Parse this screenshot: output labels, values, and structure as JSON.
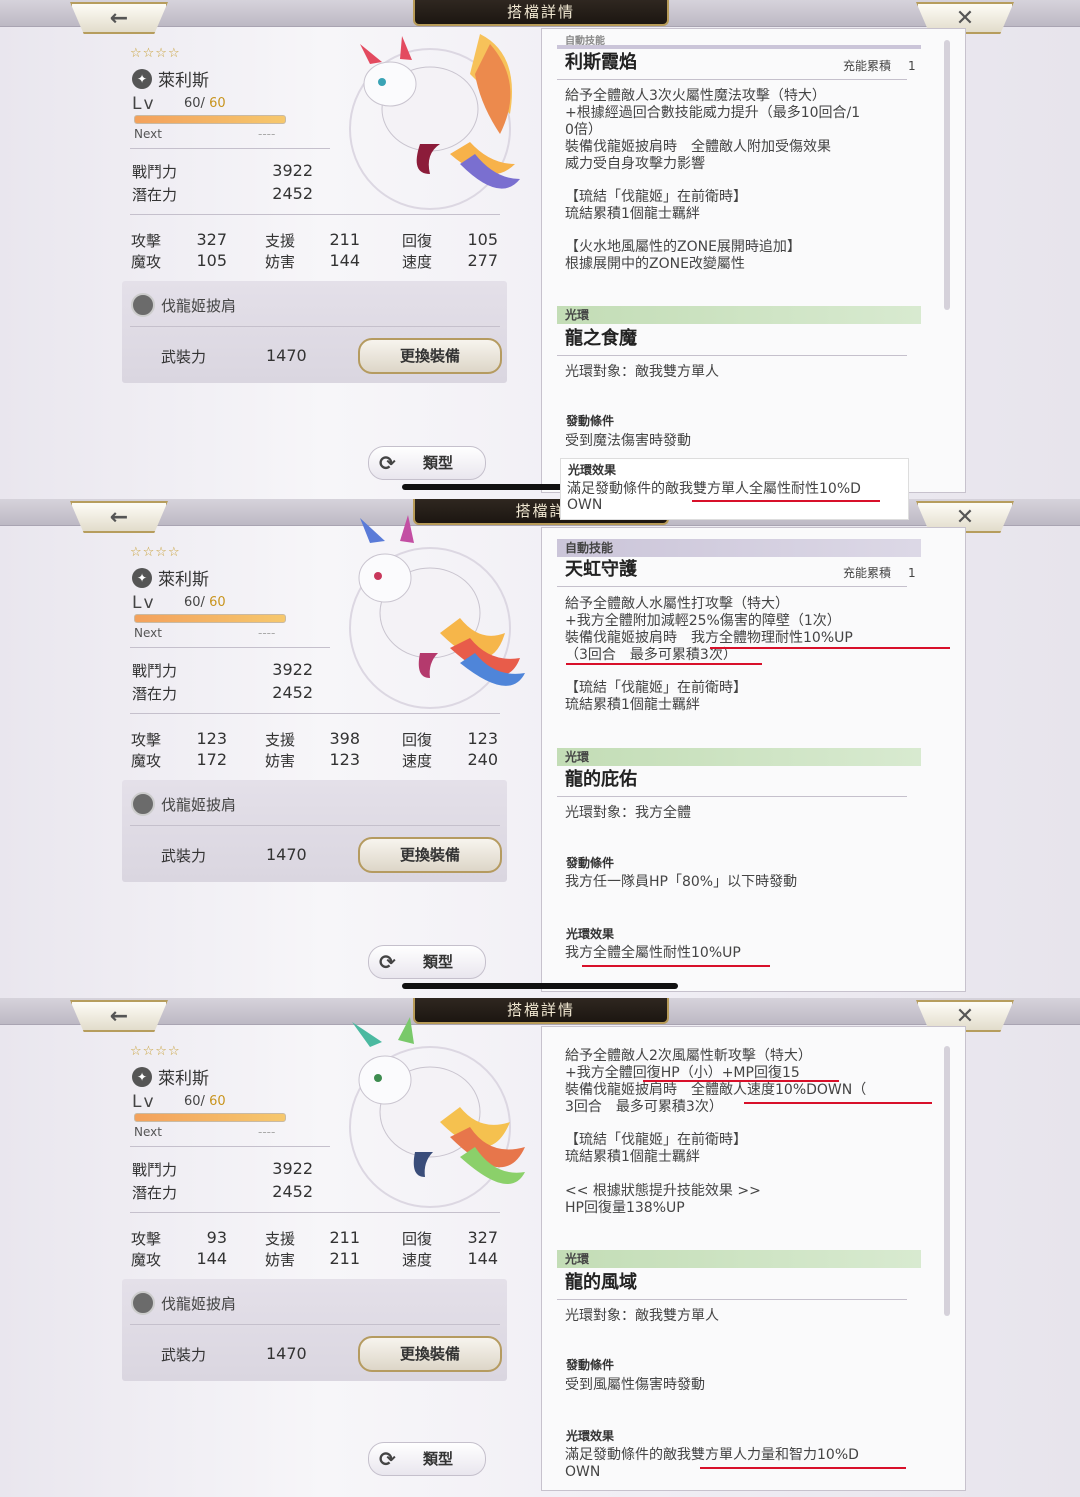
{
  "panels": [
    {
      "window_title": "搭檔詳情",
      "rarity_stars": "☆☆☆☆",
      "name": "萊利斯",
      "level_label": "Lv",
      "level": "60",
      "level_max": "60",
      "next_label": "Next",
      "next_value": "----",
      "power_label": "戰鬥力",
      "power": "3922",
      "potential_label": "潛在力",
      "potential": "2452",
      "stats": {
        "atk_label": "攻擊",
        "atk": "327",
        "sup_label": "支援",
        "sup": "211",
        "rec_label": "回復",
        "rec": "105",
        "matk_label": "魔攻",
        "matk": "105",
        "hin_label": "妨害",
        "hin": "144",
        "spd_label": "速度",
        "spd": "277"
      },
      "equip_name": "伐龍姬披肩",
      "armament_label": "武裝力",
      "armament": "1470",
      "change_button": "更換裝備",
      "type_button": "類型",
      "detail": {
        "header_partial": "自動技能",
        "skill_name": "利斯霞焰",
        "charge_label": "充能累積",
        "charge_value": "1",
        "lines": [
          "給予全體敵人3次火屬性魔法攻擊（特大）",
          "+根據經過回合數技能威力提升（最多10回合/1",
          "0倍）",
          "裝備伐龍姬披肩時　全體敵人附加受傷效果",
          "威力受自身攻擊力影響",
          "【琉結「伐龍姬」在前衛時】",
          "琉結累積1個龍士羈絆",
          "【火水地風屬性的ZONE展開時追加】",
          "根據展開中的ZONE改變屬性"
        ],
        "aura_header": "光環",
        "aura_name": "龍之食魔",
        "aura_target": "光環對象：敵我雙方單人",
        "cond_label": "發動條件",
        "cond": "受到魔法傷害時發動",
        "effect_label": "光環效果",
        "effect_1": "滿足發動條件的敵我雙方單人全屬性耐性10%D",
        "effect_2": "OWN"
      }
    },
    {
      "window_title": "搭檔詳",
      "rarity_stars": "☆☆☆☆",
      "name": "萊利斯",
      "level_label": "Lv",
      "level": "60",
      "level_max": "60",
      "next_label": "Next",
      "next_value": "----",
      "power_label": "戰鬥力",
      "power": "3922",
      "potential_label": "潛在力",
      "potential": "2452",
      "stats": {
        "atk_label": "攻擊",
        "atk": "123",
        "sup_label": "支援",
        "sup": "398",
        "rec_label": "回復",
        "rec": "123",
        "matk_label": "魔攻",
        "matk": "172",
        "hin_label": "妨害",
        "hin": "123",
        "spd_label": "速度",
        "spd": "240"
      },
      "equip_name": "伐龍姬披肩",
      "armament_label": "武裝力",
      "armament": "1470",
      "change_button": "更換裝備",
      "type_button": "類型",
      "detail": {
        "header_partial": "自動技能",
        "skill_name": "天虹守護",
        "charge_label": "充能累積",
        "charge_value": "1",
        "lines": [
          "給予全體敵人水屬性打攻擊（特大）",
          "+我方全體附加減輕25%傷害的障壁（1次）",
          "裝備伐龍姬披肩時　我方全體物理耐性10%UP",
          "（3回合　最多可累積3次）",
          "【琉結「伐龍姬」在前衛時】",
          "琉結累積1個龍士羈絆"
        ],
        "aura_header": "光環",
        "aura_name": "龍的庇佑",
        "aura_target": "光環對象：我方全體",
        "cond_label": "發動條件",
        "cond": "我方任一隊員HP「80%」以下時發動",
        "effect_label": "光環效果",
        "effect_1": "我方全體全屬性耐性10%UP",
        "effect_2": ""
      }
    },
    {
      "window_title": "搭檔詳情",
      "rarity_stars": "☆☆☆☆",
      "name": "萊利斯",
      "level_label": "Lv",
      "level": "60",
      "level_max": "60",
      "next_label": "Next",
      "next_value": "----",
      "power_label": "戰鬥力",
      "power": "3922",
      "potential_label": "潛在力",
      "potential": "2452",
      "stats": {
        "atk_label": "攻擊",
        "atk": "93",
        "sup_label": "支援",
        "sup": "211",
        "rec_label": "回復",
        "rec": "327",
        "matk_label": "魔攻",
        "matk": "144",
        "hin_label": "妨害",
        "hin": "211",
        "spd_label": "速度",
        "spd": "144"
      },
      "equip_name": "伐龍姬披肩",
      "armament_label": "武裝力",
      "armament": "1470",
      "change_button": "更換裝備",
      "type_button": "類型",
      "detail": {
        "lines": [
          "給予全體敵人2次風屬性斬攻擊（特大）",
          "+我方全體回復HP（小）+MP回復15",
          "裝備伐龍姬披肩時　全體敵人速度10%DOWN（",
          "3回合　最多可累積3次）",
          "【琉結「伐龍姬」在前衛時】",
          "琉結累積1個龍士羈絆",
          "<< 根據狀態提升技能效果 >>",
          "HP回復量138%UP"
        ],
        "aura_header": "光環",
        "aura_name": "龍的風域",
        "aura_target": "光環對象：敵我雙方單人",
        "cond_label": "發動條件",
        "cond": "受到風屬性傷害時發動",
        "effect_label": "光環效果",
        "effect_1": "滿足發動條件的敵我雙方單人力量和智力10%D",
        "effect_2": "OWN"
      }
    }
  ],
  "colors": {
    "underline": "#d8102a",
    "aura_header": "#c3ddb6",
    "gold_border": "#b79b58"
  },
  "icons": [
    "back-arrow-icon",
    "close-icon",
    "wind-element-icon",
    "equipment-icon",
    "refresh-icon",
    "star-icon"
  ]
}
